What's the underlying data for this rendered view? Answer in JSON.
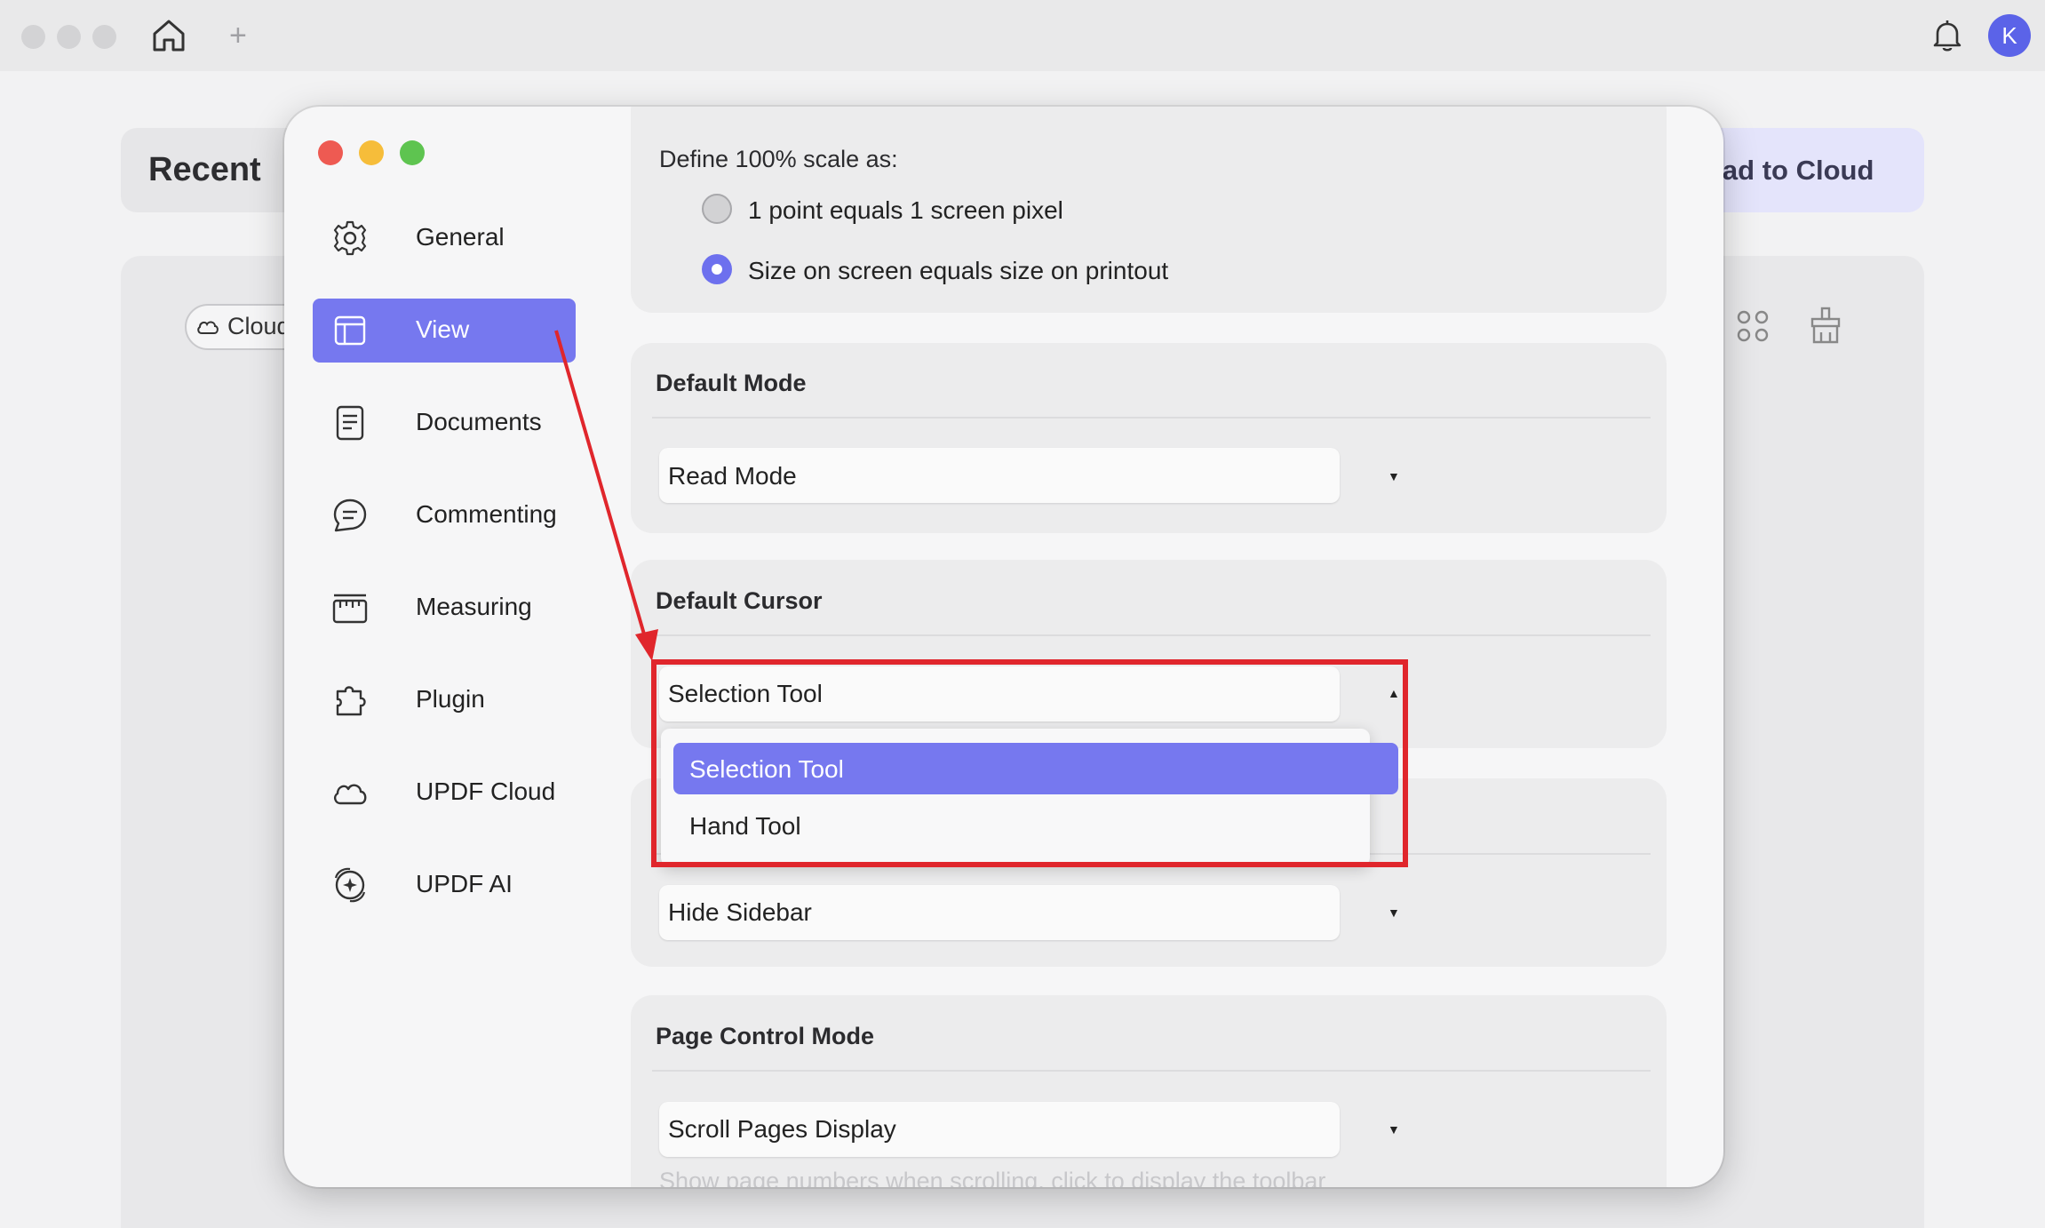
{
  "background": {
    "recent_title": "Recent",
    "upload_label": "oad to Cloud",
    "cloud_chip_label": "Cloud",
    "avatar_letter": "K"
  },
  "sidebar": {
    "items": [
      {
        "label": "General",
        "icon": "gear-icon"
      },
      {
        "label": "View",
        "icon": "view-icon",
        "active": true
      },
      {
        "label": "Documents",
        "icon": "document-icon"
      },
      {
        "label": "Commenting",
        "icon": "comment-icon"
      },
      {
        "label": "Measuring",
        "icon": "ruler-icon"
      },
      {
        "label": "Plugin",
        "icon": "puzzle-icon"
      },
      {
        "label": "UPDF Cloud",
        "icon": "cloud-icon"
      },
      {
        "label": "UPDF AI",
        "icon": "ai-icon"
      }
    ]
  },
  "scale": {
    "heading": "Define 100% scale as:",
    "options": [
      {
        "label": "1 point equals 1 screen pixel",
        "selected": false
      },
      {
        "label": "Size on screen equals size on printout",
        "selected": true
      }
    ]
  },
  "default_mode": {
    "title": "Default Mode",
    "value": "Read Mode"
  },
  "default_cursor": {
    "title": "Default Cursor",
    "value": "Selection Tool",
    "options": [
      "Selection Tool",
      "Hand Tool"
    ]
  },
  "sidebar_setting": {
    "value": "Hide Sidebar"
  },
  "page_control": {
    "title": "Page Control Mode",
    "value": "Scroll Pages Display"
  },
  "hint_text": "Show page numbers when scrolling, click to display the toolbar",
  "colors": {
    "accent": "#7678ef",
    "annotation": "#e0262c"
  }
}
